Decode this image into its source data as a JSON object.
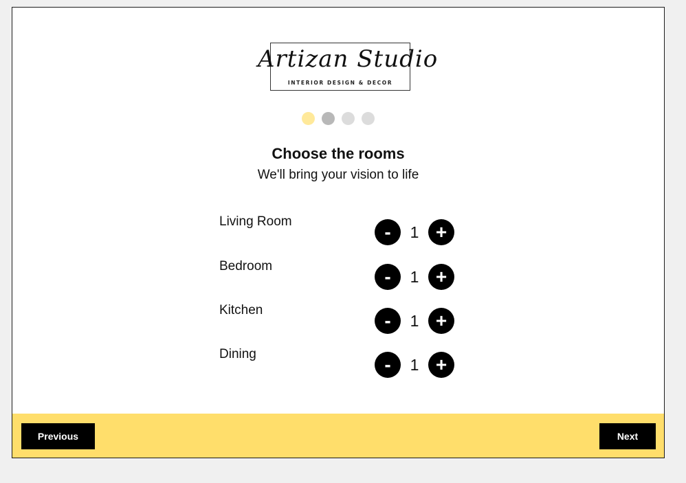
{
  "brand": {
    "name": "Artizan Studio",
    "tagline": "INTERIOR DESIGN & DECOR"
  },
  "progress": {
    "total_steps": 4,
    "current_step": 1,
    "colors": {
      "active": "#ffe99a",
      "done": "#b8b8b8",
      "pending": "#dcdcdc"
    }
  },
  "heading": {
    "title": "Choose the rooms",
    "subtitle": "We'll bring your vision to life"
  },
  "rooms": [
    {
      "label": "Living Room",
      "count": "1",
      "minus": "-",
      "plus": "+"
    },
    {
      "label": "Bedroom",
      "count": "1",
      "minus": "-",
      "plus": "+"
    },
    {
      "label": "Kitchen",
      "count": "1",
      "minus": "-",
      "plus": "+"
    },
    {
      "label": "Dining",
      "count": "1",
      "minus": "-",
      "plus": "+"
    }
  ],
  "footer": {
    "previous_label": "Previous",
    "next_label": "Next",
    "background": "#ffde6b"
  }
}
